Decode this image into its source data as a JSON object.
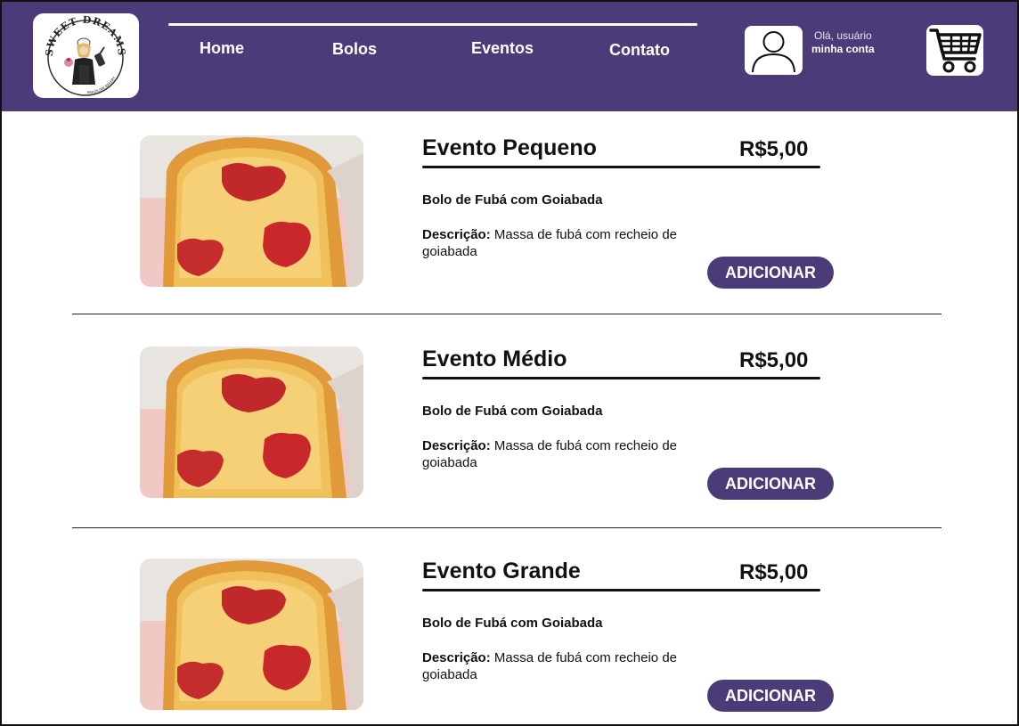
{
  "header": {
    "logo": {
      "text_top": "SWEET DREAMS",
      "text_bottom": "BRAZILIAN BAKERY"
    },
    "nav": [
      {
        "label": "Home"
      },
      {
        "label": "Bolos"
      },
      {
        "label": "Eventos"
      },
      {
        "label": "Contato"
      }
    ],
    "account": {
      "greeting": "Olá, usuário",
      "link": "minha conta"
    },
    "avatar_icon": "user-icon",
    "cart_icon": "cart-icon"
  },
  "products": [
    {
      "title": "Evento Pequeno",
      "price": "R$5,00",
      "name": "Bolo de Fubá com Goiabada",
      "desc_label": "Descrição:",
      "desc": "Massa de fubá com recheio de goiabada",
      "button": "ADICIONAR"
    },
    {
      "title": "Evento Médio",
      "price": "R$5,00",
      "name": "Bolo de Fubá com Goiabada",
      "desc_label": "Descrição:",
      "desc": "Massa de fubá com recheio de goiabada",
      "button": "ADICIONAR"
    },
    {
      "title": "Evento Grande",
      "price": "R$5,00",
      "name": "Bolo de Fubá com Goiabada",
      "desc_label": "Descrição:",
      "desc": "Massa de fubá com recheio de goiabada",
      "button": "ADICIONAR"
    }
  ],
  "colors": {
    "brand": "#4b3b78",
    "background": "#ffffff",
    "text": "#111111"
  }
}
